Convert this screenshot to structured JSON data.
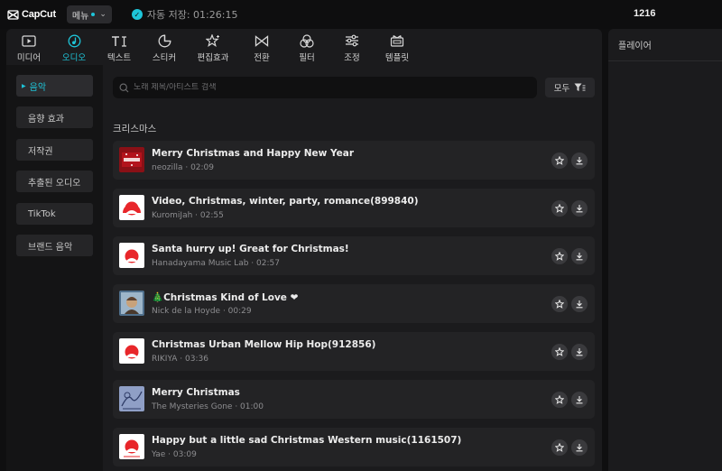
{
  "app": {
    "logo_text": "CapCut",
    "menu_label": "메뉴",
    "autosave_text": "자동 저장: 01:26:15",
    "project_name": "1216"
  },
  "toolbar": {
    "tools": [
      {
        "label": "미디어",
        "icon": "media-icon",
        "active": false
      },
      {
        "label": "오디오",
        "icon": "audio-icon",
        "active": true
      },
      {
        "label": "텍스트",
        "icon": "text-icon",
        "active": false
      },
      {
        "label": "스티커",
        "icon": "sticker-icon",
        "active": false
      },
      {
        "label": "편집효과",
        "icon": "effects-icon",
        "active": false
      },
      {
        "label": "전환",
        "icon": "transition-icon",
        "active": false
      },
      {
        "label": "필터",
        "icon": "filter-icon",
        "active": false
      },
      {
        "label": "조정",
        "icon": "adjust-icon",
        "active": false
      },
      {
        "label": "템플릿",
        "icon": "template-icon",
        "active": false
      }
    ]
  },
  "sidebar": {
    "items": [
      {
        "label": "음악",
        "active": true
      },
      {
        "label": "음향 효과",
        "active": false
      },
      {
        "label": "저작권",
        "active": false
      },
      {
        "label": "추출된 오디오",
        "active": false
      },
      {
        "label": "TikTok",
        "active": false
      },
      {
        "label": "브랜드 음악",
        "active": false
      }
    ]
  },
  "search": {
    "placeholder": "노래 제목/아티스트 검색",
    "value": ""
  },
  "filter": {
    "label": "모두"
  },
  "section": {
    "title": "크리스마스"
  },
  "tracks": [
    {
      "title": "Merry Christmas and Happy New Year",
      "meta": "neozilla · 02:09",
      "thumb": "red-christmas-cover"
    },
    {
      "title": "Video, Christmas, winter, party, romance(899840)",
      "meta": "KuromiJah · 02:55",
      "thumb": "red-arc-logo"
    },
    {
      "title": "Santa hurry up! Great for Christmas!",
      "meta": "Hanadayama Music Lab · 02:57",
      "thumb": "red-arc-logo"
    },
    {
      "title": "🎄Christmas Kind of Love ❤",
      "meta": "Nick de la Hoyde · 00:29",
      "thumb": "portrait-cover"
    },
    {
      "title": "Christmas Urban Mellow Hip Hop(912856)",
      "meta": "RIKIYA · 03:36",
      "thumb": "red-arc-logo"
    },
    {
      "title": "Merry Christmas",
      "meta": "The Mysteries Gone · 01:00",
      "thumb": "blue-sketch-cover"
    },
    {
      "title": "Happy but a little sad Christmas Western music(1161507)",
      "meta": "Yae · 03:09",
      "thumb": "red-arc-logo"
    }
  ],
  "right_panel": {
    "title": "플레이어"
  },
  "colors": {
    "accent": "#1ec5d9",
    "background": "#0f0f10",
    "panel": "#1b1b1d",
    "track_row": "#232325",
    "brand_red": "#e8262a"
  }
}
